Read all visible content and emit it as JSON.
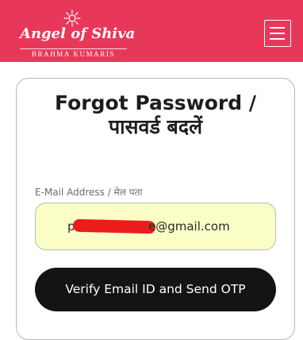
{
  "header": {
    "logo_title": "Angel of Shiva",
    "logo_subtitle": "BRAHMA KUMARIS",
    "logo_sun_icon": "sun-icon",
    "menu_icon": "hamburger-menu-icon",
    "background_color": "#e8385a"
  },
  "form": {
    "title_en": "Forgot Password /",
    "title_hi": "पासवर्ड बदलें",
    "email_label": "E-Mail Address / मेल पता",
    "email_prefix": "p",
    "email_value": "e@gmail.com",
    "email_bg_color": "#fafdc5",
    "submit_label": "Verify Email ID and Send OTP",
    "submit_color": "#141414"
  }
}
